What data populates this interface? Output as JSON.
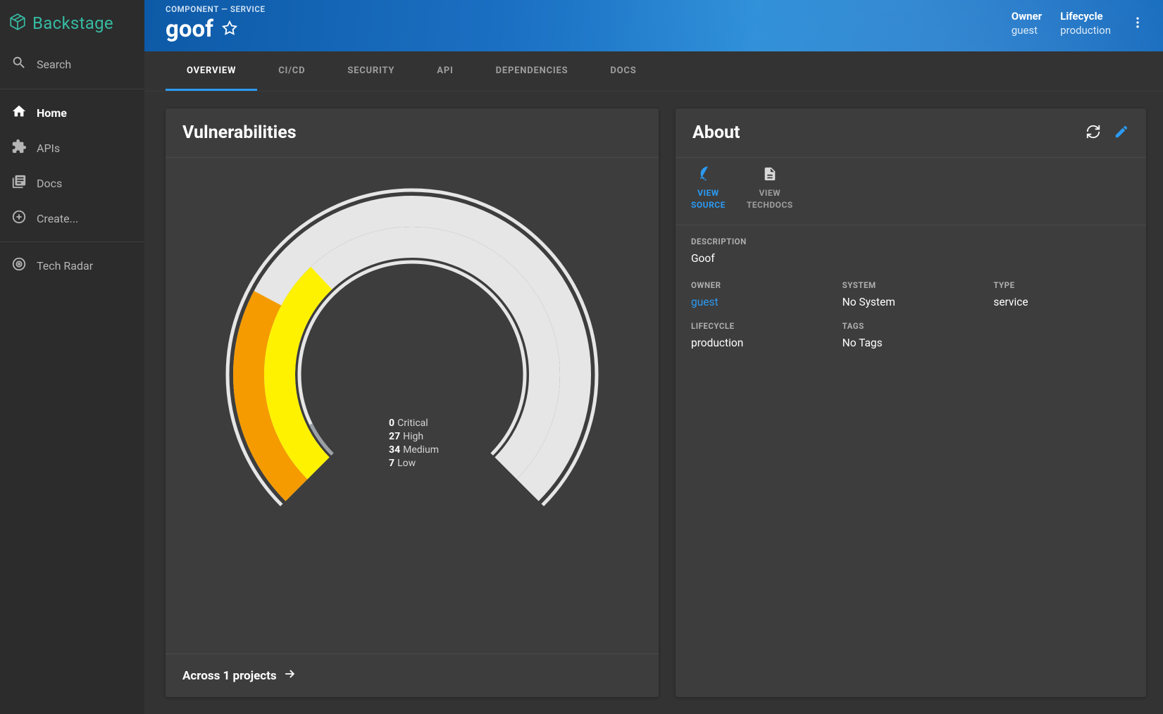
{
  "app": {
    "name": "Backstage"
  },
  "sidebar": {
    "search_label": "Search",
    "items": [
      {
        "icon": "home",
        "label": "Home",
        "active": true
      },
      {
        "icon": "extension",
        "label": "APIs",
        "active": false
      },
      {
        "icon": "library-books",
        "label": "Docs",
        "active": false
      },
      {
        "icon": "add-circle",
        "label": "Create...",
        "active": false
      }
    ],
    "secondary": [
      {
        "icon": "target",
        "label": "Tech Radar"
      }
    ]
  },
  "header": {
    "breadcrumb": "COMPONENT — SERVICE",
    "title": "goof",
    "meta": {
      "owner_label": "Owner",
      "owner_value": "guest",
      "lifecycle_label": "Lifecycle",
      "lifecycle_value": "production"
    }
  },
  "tabs": [
    {
      "label": "OVERVIEW",
      "active": true
    },
    {
      "label": "CI/CD",
      "active": false
    },
    {
      "label": "SECURITY",
      "active": false
    },
    {
      "label": "API",
      "active": false
    },
    {
      "label": "DEPENDENCIES",
      "active": false
    },
    {
      "label": "DOCS",
      "active": false
    }
  ],
  "vulnerabilities": {
    "title": "Vulnerabilities",
    "footer": "Across 1 projects",
    "legend": {
      "critical_count": "0",
      "critical_label": "Critical",
      "high_count": "27",
      "high_label": "High",
      "medium_count": "34",
      "medium_label": "Medium",
      "low_count": "7",
      "low_label": "Low"
    }
  },
  "about": {
    "title": "About",
    "links": {
      "view_source": "VIEW SOURCE",
      "view_techdocs": "VIEW TECHDOCS"
    },
    "description_label": "DESCRIPTION",
    "description_value": "Goof",
    "owner_label": "OWNER",
    "owner_value": "guest",
    "system_label": "SYSTEM",
    "system_value": "No System",
    "type_label": "TYPE",
    "type_value": "service",
    "lifecycle_label": "LIFECYCLE",
    "lifecycle_value": "production",
    "tags_label": "TAGS",
    "tags_value": "No Tags"
  },
  "chart_data": {
    "type": "gauge",
    "series": [
      {
        "name": "Critical",
        "value": 0,
        "max": 100,
        "color": "#e53935"
      },
      {
        "name": "High",
        "value": 27,
        "max": 100,
        "color": "#f59b00"
      },
      {
        "name": "Medium",
        "value": 34,
        "max": 100,
        "color": "#fff200"
      },
      {
        "name": "Low",
        "value": 7,
        "max": 100,
        "color": "#9aa0a6"
      }
    ],
    "start_angle_deg": -225,
    "sweep_deg": 270,
    "track_color": "#e6e6e6",
    "thin_track_color": "#e6e6e6"
  }
}
